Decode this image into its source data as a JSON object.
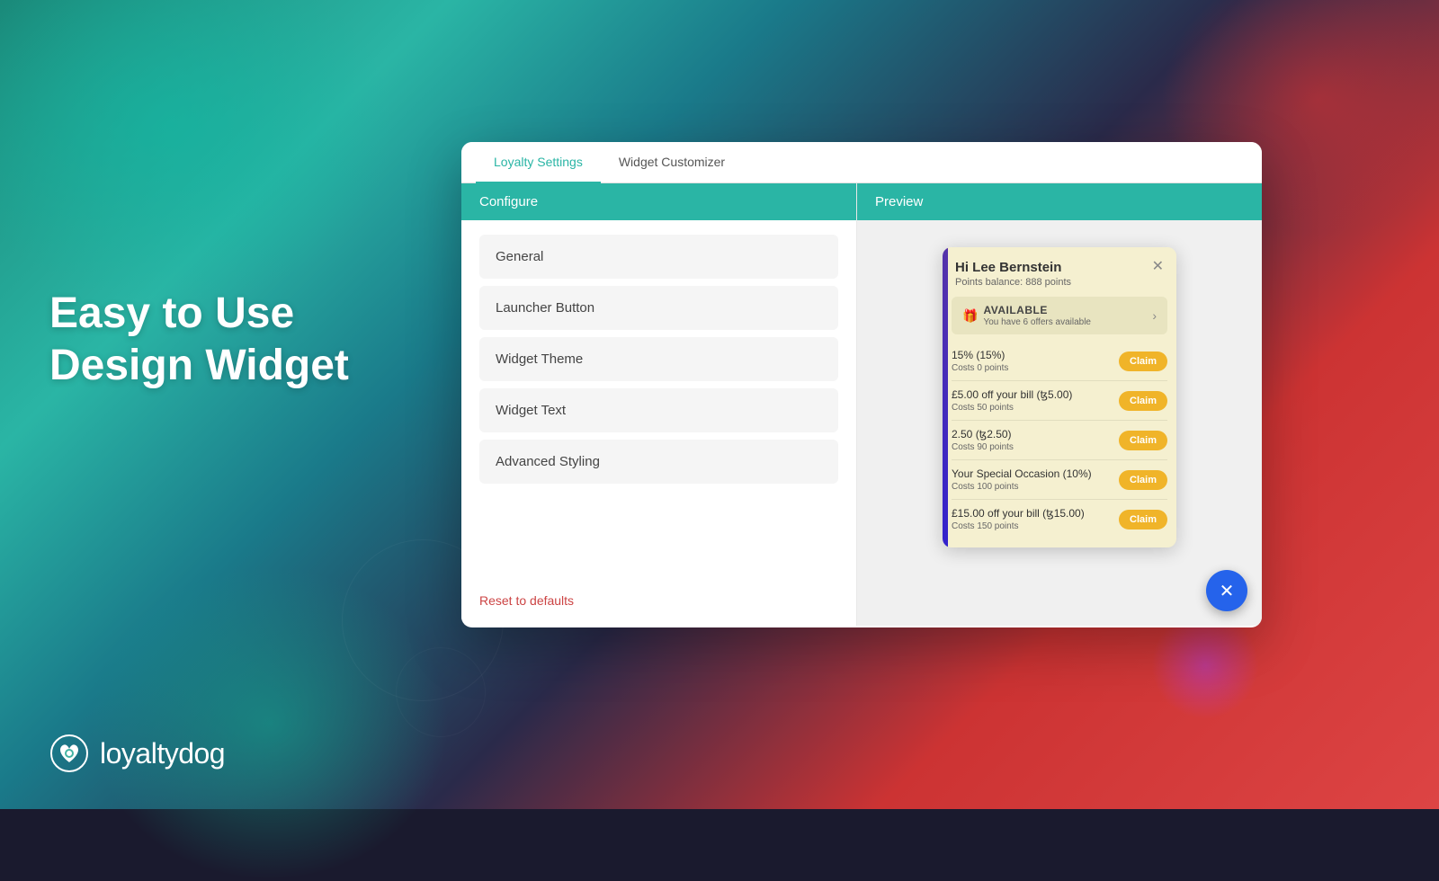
{
  "background": {
    "color": "#1a8a7a"
  },
  "hero": {
    "line1": "Easy to Use",
    "line2": "Design Widget"
  },
  "logo": {
    "text": "loyaltydog"
  },
  "tabs": [
    {
      "id": "loyalty-settings",
      "label": "Loyalty Settings",
      "active": true
    },
    {
      "id": "widget-customizer",
      "label": "Widget Customizer",
      "active": false
    }
  ],
  "configure": {
    "header": "Configure",
    "menu_items": [
      {
        "id": "general",
        "label": "General"
      },
      {
        "id": "launcher-button",
        "label": "Launcher Button"
      },
      {
        "id": "widget-theme",
        "label": "Widget Theme"
      },
      {
        "id": "widget-text",
        "label": "Widget Text"
      },
      {
        "id": "advanced-styling",
        "label": "Advanced Styling"
      }
    ],
    "reset_label": "Reset to defaults"
  },
  "preview": {
    "header": "Preview",
    "widget": {
      "greeting": "Hi Lee Bernstein",
      "points_balance": "Points balance: 888 points",
      "available_label": "AVAILABLE",
      "available_icon": "🎁",
      "available_sub": "You have 6 offers available",
      "offers": [
        {
          "title": "15% (15%)",
          "cost": "Costs 0 points",
          "claim_label": "Claim"
        },
        {
          "title": "£5.00 off your bill (ꜩ5.00)",
          "cost": "Costs 50 points",
          "claim_label": "Claim"
        },
        {
          "title": "2.50 (ꜩ2.50)",
          "cost": "Costs 90 points",
          "claim_label": "Claim"
        },
        {
          "title": "Your Special Occasion (10%)",
          "cost": "Costs 100 points",
          "claim_label": "Claim"
        },
        {
          "title": "£15.00 off your bill (ꜩ15.00)",
          "cost": "Costs 150 points",
          "claim_label": "Claim"
        }
      ]
    }
  }
}
